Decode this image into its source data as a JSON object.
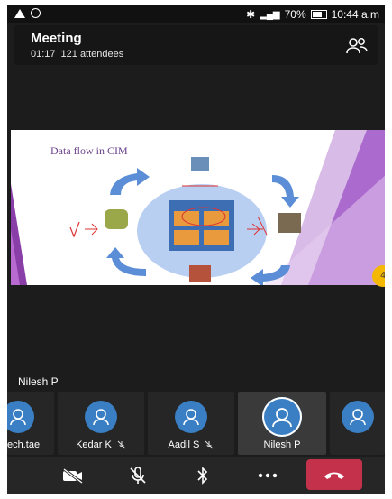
{
  "status_bar": {
    "right_text": "70%",
    "time": "10:44 a.m"
  },
  "header": {
    "title": "Meeting",
    "duration": "01:17",
    "attendees": "121 attendees"
  },
  "shared_content": {
    "slide_title": "Data flow in CIM",
    "page_badge": "4"
  },
  "active_speaker": "Nilesh P",
  "participants": [
    {
      "name": "ech.tae",
      "muted": false
    },
    {
      "name": "Kedar K",
      "muted": true
    },
    {
      "name": "Aadil S",
      "muted": true
    },
    {
      "name": "Nilesh P",
      "muted": false,
      "active": true
    },
    {
      "name": "",
      "muted": false
    }
  ],
  "controls": [
    "camera-off",
    "mic-off",
    "bluetooth",
    "more",
    "hang-up"
  ],
  "colors": {
    "background": "#1c1c1c",
    "avatar": "#3a7fc4",
    "hangup": "#c4314b",
    "badge": "#f5b800"
  }
}
